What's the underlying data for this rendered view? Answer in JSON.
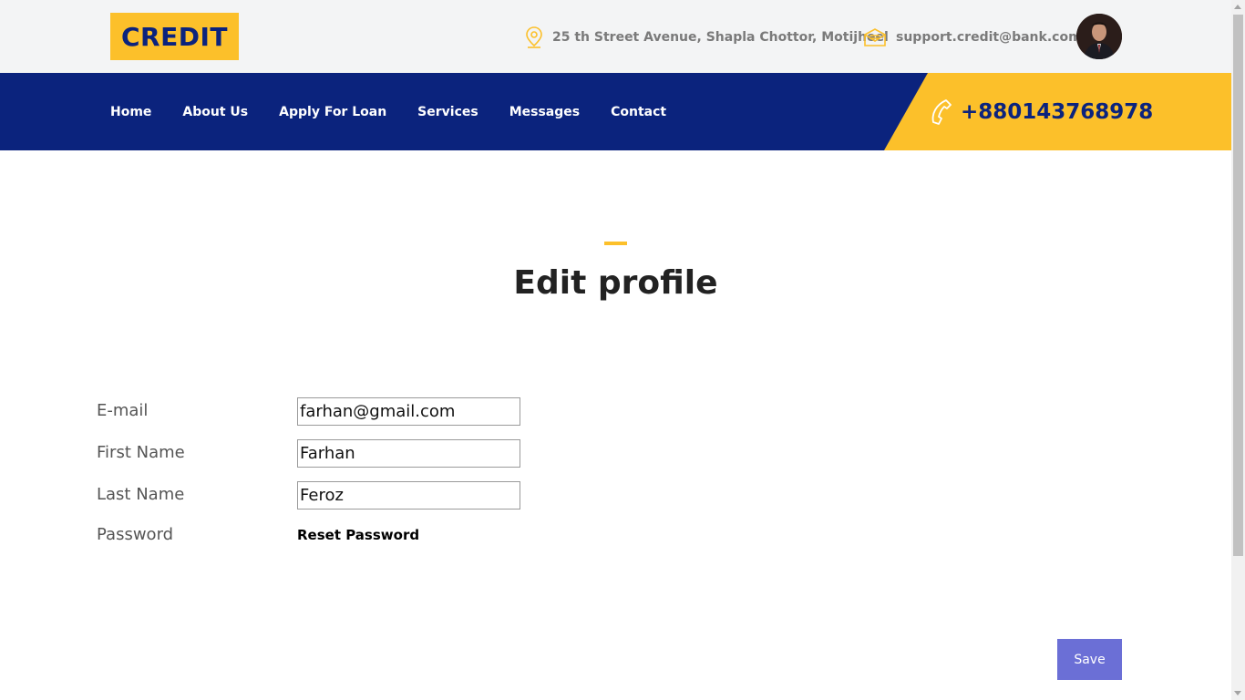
{
  "header": {
    "logo_text": "CREDIT",
    "address": "25 th Street Avenue, Shapla Chottor, Motijheel",
    "email": "support.credit@bank.com",
    "address_icon": "map-pin-icon",
    "email_icon": "envelope-icon"
  },
  "nav": {
    "items": [
      {
        "label": "Home"
      },
      {
        "label": "About Us"
      },
      {
        "label": "Apply For Loan"
      },
      {
        "label": "Services"
      },
      {
        "label": "Messages"
      },
      {
        "label": "Contact"
      }
    ],
    "phone": "+880143768978",
    "phone_icon": "phone-icon"
  },
  "main": {
    "title": "Edit profile",
    "fields": [
      {
        "label": "E-mail",
        "value": "farhan@gmail.com"
      },
      {
        "label": "First Name",
        "value": "Farhan"
      },
      {
        "label": "Last Name",
        "value": "Feroz"
      }
    ],
    "password_label": "Password",
    "reset_password_label": "Reset Password",
    "save_label": "Save"
  },
  "colors": {
    "brand_navy": "#0b237d",
    "brand_yellow": "#fcc02a",
    "button": "#6b6fd6"
  }
}
